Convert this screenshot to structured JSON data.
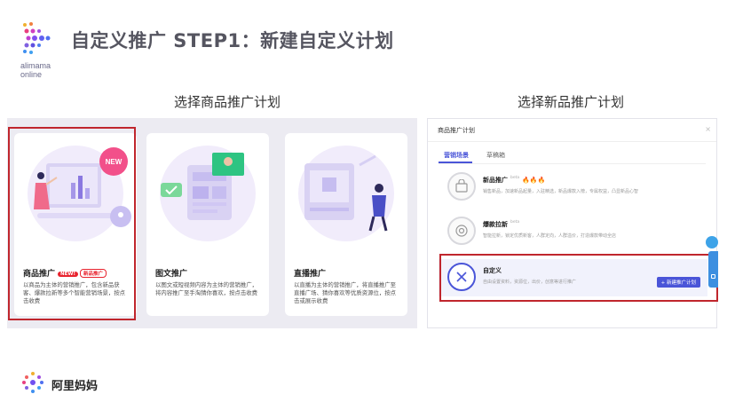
{
  "header": {
    "logo_text_line1": "alimama",
    "logo_text_line2": "online",
    "title": "自定义推广 STEP1：新建自定义计划"
  },
  "labels": {
    "left": "选择商品推广计划",
    "right": "选择新品推广计划"
  },
  "cards": [
    {
      "title": "商品推广",
      "badge_new": "NEW!",
      "badge_tag": "新品推广",
      "art_badge": "NEW",
      "desc": "以商品为主体的营销推广，包含新品获客、爆款拉新等多个智能营销场景，按点击收费"
    },
    {
      "title": "图文推广",
      "desc": "以图文或短视频内容为主体的营销推广，将内容推广至手淘猜你喜欢，按点击收费"
    },
    {
      "title": "直播推广",
      "desc": "以直播为主体的营销推广，将直播推广至直播广场、猜你喜欢等优质资源位，按点击或展示收费"
    }
  ],
  "dialog": {
    "title": "商品推广计划",
    "close": "×",
    "tabs": [
      "营销场景",
      "草稿箱"
    ],
    "rows": [
      {
        "name": "新品推广",
        "beta": "beta",
        "fire": "🔥🔥🔥",
        "desc": "销售新品，加速新品起量，入驻精选，新品爆款入榜，专属权益，凸显新品心智"
      },
      {
        "name": "爆款拉新",
        "beta": "beta",
        "desc": "智能拉新，锁定优质新客，人群定向，人群溢价，打造爆款带动全店"
      },
      {
        "name": "自定义",
        "desc": "自由设置资料，资源位，出价，创意等进行推广",
        "button": "+ 新建推广计划"
      }
    ]
  },
  "footer": {
    "brand": "阿里妈妈"
  },
  "colors": {
    "accent": "#4a55d8",
    "highlight": "#c0262d",
    "panel_bg": "#ecebf2",
    "title_gray": "#555560"
  }
}
